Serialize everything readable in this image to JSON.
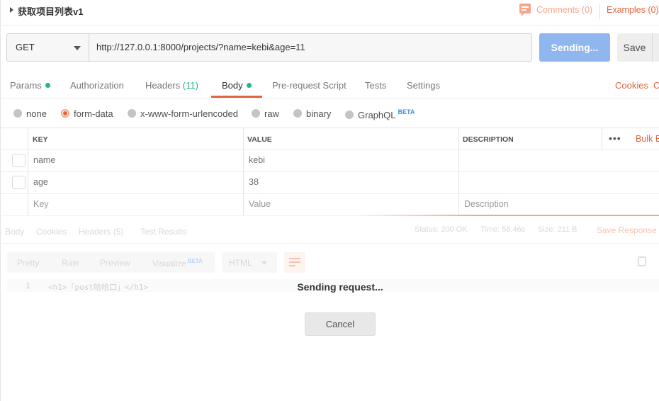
{
  "header": {
    "request_title": "获取项目列表v1",
    "comments_label": "Comments (0)",
    "examples_label": "Examples (0)"
  },
  "url_bar": {
    "method": "GET",
    "url": "http://127.0.0.1:8000/projects/?name=kebi&age=11",
    "send_label": "Sending...",
    "save_label": "Save"
  },
  "request_tabs": {
    "params": "Params",
    "authorization": "Authorization",
    "headers": "Headers",
    "headers_count": "(11)",
    "body": "Body",
    "pre_request": "Pre-request Script",
    "tests": "Tests",
    "settings": "Settings",
    "active": "Body",
    "cookies": "Cookies",
    "code": "C"
  },
  "body_types": {
    "options": [
      "none",
      "form-data",
      "x-www-form-urlencoded",
      "raw",
      "binary",
      "GraphQL"
    ],
    "selected": "form-data",
    "graphql_badge": "BETA"
  },
  "params_table": {
    "headers": {
      "key": "KEY",
      "value": "VALUE",
      "description": "DESCRIPTION"
    },
    "more": "•••",
    "bulk_edit": "Bulk E",
    "rows": [
      {
        "key": "name",
        "value": "kebi",
        "description": ""
      },
      {
        "key": "age",
        "value": "38",
        "description": ""
      }
    ],
    "placeholders": {
      "key": "Key",
      "value": "Value",
      "description": "Description"
    }
  },
  "response": {
    "tabs": [
      "Body",
      "Cookies",
      "Headers (5)",
      "Test Results"
    ],
    "status_label": "Status:",
    "status_value": "200 OK",
    "time_label": "Time:",
    "time_value": "58.46s",
    "size_label": "Size:",
    "size_value": "211 B",
    "save_response": "Save Response",
    "view_modes": [
      "Pretty",
      "Raw",
      "Preview",
      "Visualize"
    ],
    "visualize_badge": "BETA",
    "format": "HTML",
    "line_number": "1",
    "code": "<h1>「post哈哈口」</h1>"
  },
  "overlay": {
    "message": "Sending request...",
    "cancel_label": "Cancel"
  },
  "colors": {
    "accent": "#e2643d",
    "send_button": "#8fb6ee",
    "green": "#26b47f",
    "beta": "#3e8ef7"
  }
}
